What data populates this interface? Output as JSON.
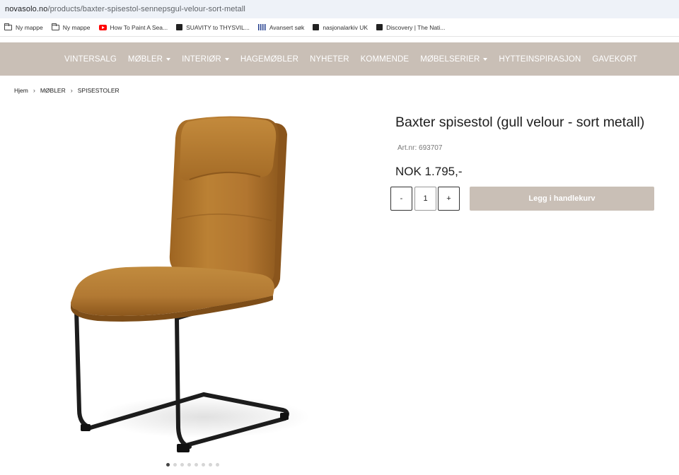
{
  "browser": {
    "url_host": "novasolo.no",
    "url_path": "/products/baxter-spisestol-sennepsgul-velour-sort-metall"
  },
  "bookmarks": [
    {
      "label": "Ny mappe",
      "icon": "folder-icon"
    },
    {
      "label": "Ny mappe",
      "icon": "folder-icon"
    },
    {
      "label": "How To Paint A Sea...",
      "icon": "youtube-icon"
    },
    {
      "label": "SUAVITY to THYSVIL...",
      "icon": "document-icon"
    },
    {
      "label": "Avansert søk",
      "icon": "barcode-icon"
    },
    {
      "label": "nasjonalarkiv UK",
      "icon": "document-icon"
    },
    {
      "label": "Discovery | The Nati...",
      "icon": "document-icon"
    }
  ],
  "nav": {
    "items": [
      {
        "label": "VINTERSALG",
        "dropdown": false
      },
      {
        "label": "MØBLER",
        "dropdown": true
      },
      {
        "label": "INTERIØR",
        "dropdown": true
      },
      {
        "label": "HAGEMØBLER",
        "dropdown": false
      },
      {
        "label": "NYHETER",
        "dropdown": false
      },
      {
        "label": "KOMMENDE",
        "dropdown": false
      },
      {
        "label": "MØBELSERIER",
        "dropdown": true
      },
      {
        "label": "HYTTEINSPIRASJON",
        "dropdown": false
      },
      {
        "label": "GAVEKORT",
        "dropdown": false
      }
    ]
  },
  "breadcrumb": [
    "Hjem",
    "MØBLER",
    "SPISESTOLER"
  ],
  "product": {
    "title": "Baxter spisestol (gull velour - sort metall)",
    "art_nr": "Art.nr: 693707",
    "price": "NOK 1.795,-",
    "image_alt": "chair-image"
  },
  "quantity": {
    "minus": "-",
    "value": "1",
    "plus": "+"
  },
  "add_to_cart_label": "Legg i handlekurv",
  "carousel": {
    "active_index": 0
  },
  "colors": {
    "nav_bg": "#c9bfb6",
    "button_bg": "#c9bfb6",
    "velour": "#b47a2c",
    "metal": "#1c1c1c"
  }
}
